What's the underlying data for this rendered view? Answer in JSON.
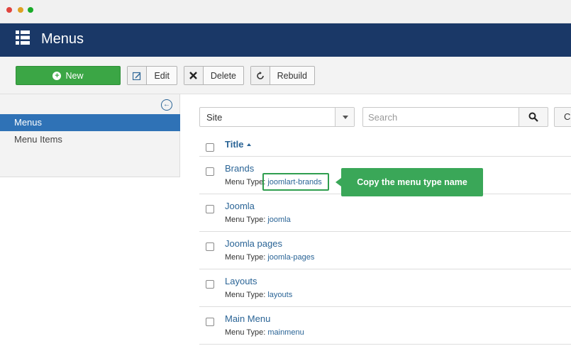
{
  "window": {
    "controls": [
      "close",
      "minimize",
      "zoom"
    ]
  },
  "header": {
    "icon": "list-icon",
    "title": "Menus"
  },
  "toolbar": {
    "new_label": "New",
    "edit_label": "Edit",
    "delete_label": "Delete",
    "rebuild_label": "Rebuild"
  },
  "sidebar": {
    "collapse_icon": "collapse-left-icon",
    "items": [
      {
        "label": "Menus",
        "active": true
      },
      {
        "label": "Menu Items",
        "active": false
      }
    ]
  },
  "filters": {
    "client_select": "Site",
    "search_placeholder": "Search",
    "clear_label": "C"
  },
  "table": {
    "title_header": "Title",
    "sort": "ascending",
    "meta_label": "Menu Type:",
    "rows": [
      {
        "title": "Brands",
        "menu_type": "joomlart-brands"
      },
      {
        "title": "Joomla",
        "menu_type": "joomla"
      },
      {
        "title": "Joomla pages",
        "menu_type": "joomla-pages"
      },
      {
        "title": "Layouts",
        "menu_type": "layouts"
      },
      {
        "title": "Main Menu",
        "menu_type": "mainmenu"
      }
    ]
  },
  "annotation": {
    "callout_text": "Copy the menu type name",
    "color": "#3aa758"
  },
  "colors": {
    "header_bg": "#1a3867",
    "accent": "#2f72b6",
    "new_button": "#3ba645",
    "link": "#2a6496"
  }
}
